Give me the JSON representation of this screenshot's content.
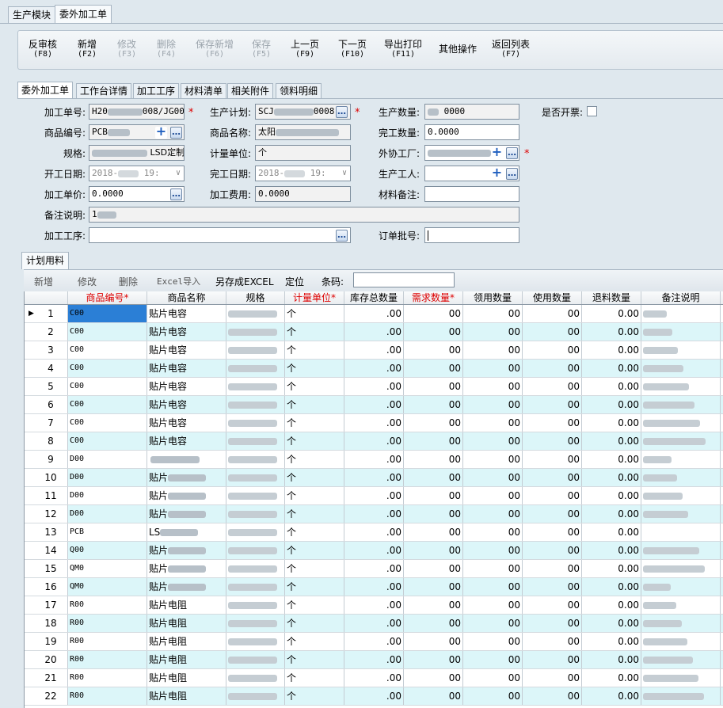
{
  "top_tabs": [
    {
      "label": "生产模块",
      "active": false
    },
    {
      "label": "委外加工单",
      "active": true
    }
  ],
  "toolbar": [
    {
      "label": "反审核",
      "key": "(F8)",
      "enabled": true
    },
    {
      "label": "新增",
      "key": "(F2)",
      "enabled": true
    },
    {
      "label": "修改",
      "key": "(F3)",
      "enabled": false
    },
    {
      "label": "删除",
      "key": "(F4)",
      "enabled": false
    },
    {
      "label": "保存新增",
      "key": "(F6)",
      "enabled": false
    },
    {
      "label": "保存",
      "key": "(F5)",
      "enabled": false
    },
    {
      "label": "上一页",
      "key": "(F9)",
      "enabled": true
    },
    {
      "label": "下一页",
      "key": "(F10)",
      "enabled": true
    },
    {
      "label": "导出打印",
      "key": "(F11)",
      "enabled": true
    },
    {
      "label": "其他操作",
      "key": "",
      "enabled": true
    },
    {
      "label": "返回列表",
      "key": "(F7)",
      "enabled": true
    }
  ],
  "sub_tabs": [
    {
      "label": "委外加工单",
      "active": true
    },
    {
      "label": "工作台详情",
      "active": false
    },
    {
      "label": "加工工序",
      "active": false
    },
    {
      "label": "材料清单",
      "active": false
    },
    {
      "label": "相关附件",
      "active": false
    },
    {
      "label": "领料明细",
      "active": false
    }
  ],
  "form": {
    "order_no_label": "加工单号:",
    "order_no_prefix": "H20",
    "order_no_suffix": "008/JG001",
    "plan_label": "生产计划:",
    "plan_prefix": "SCJ",
    "plan_suffix": "0008",
    "qty_label": "生产数量:",
    "qty_value": "0000",
    "invoice_label": "是否开票:",
    "product_code_label": "商品编号:",
    "product_code_value": "PCB",
    "product_name_label": "商品名称:",
    "product_name_value": "太阳",
    "done_qty_label": "完工数量:",
    "done_qty_value": "0.0000",
    "spec_label": "规格:",
    "spec_value": "LSD定制",
    "unit_label": "计量单位:",
    "unit_value": "个",
    "factory_label": "外协工厂:",
    "start_label": "开工日期:",
    "start_value": "2018-",
    "start_time": "19:",
    "end_label": "完工日期:",
    "end_value": "2018-",
    "end_time": "19:",
    "worker_label": "生产工人:",
    "price_label": "加工单价:",
    "price_value": "0.0000",
    "fee_label": "加工费用:",
    "fee_value": "0.0000",
    "material_note_label": "材料备注:",
    "remark_label": "备注说明:",
    "remark_value": "1",
    "process_label": "加工工序:",
    "batch_label": "订单批号:"
  },
  "grid_tab": "计划用料",
  "grid_toolbar": {
    "add": "新增",
    "edit": "修改",
    "delete": "删除",
    "excel_import": "Excel导入",
    "save_excel": "另存成EXCEL",
    "locate": "定位",
    "barcode_label": "条码:"
  },
  "columns": [
    "",
    "商品编号*",
    "商品名称",
    "规格",
    "计量单位*",
    "库存总数量",
    "需求数量*",
    "领用数量",
    "使用数量",
    "退料数量",
    "备注说明"
  ],
  "rows": [
    {
      "n": "1",
      "code": "C00",
      "name": "贴片电容",
      "unit": "个",
      "stock": ".00",
      "need": "00",
      "take": "00",
      "use": "00",
      "ret": "0.00"
    },
    {
      "n": "2",
      "code": "C00",
      "name": "贴片电容",
      "unit": "个",
      "stock": ".00",
      "need": "00",
      "take": "00",
      "use": "00",
      "ret": "0.00"
    },
    {
      "n": "3",
      "code": "C00",
      "name": "贴片电容",
      "unit": "个",
      "stock": ".00",
      "need": "00",
      "take": "00",
      "use": "00",
      "ret": "0.00"
    },
    {
      "n": "4",
      "code": "C00",
      "name": "贴片电容",
      "unit": "个",
      "stock": ".00",
      "need": "00",
      "take": "00",
      "use": "00",
      "ret": "0.00"
    },
    {
      "n": "5",
      "code": "C00",
      "name": "贴片电容",
      "unit": "个",
      "stock": ".00",
      "need": "00",
      "take": "00",
      "use": "00",
      "ret": "0.00"
    },
    {
      "n": "6",
      "code": "C00",
      "name": "贴片电容",
      "unit": "个",
      "stock": ".00",
      "need": "00",
      "take": "00",
      "use": "00",
      "ret": "0.00"
    },
    {
      "n": "7",
      "code": "C00",
      "name": "贴片电容",
      "unit": "个",
      "stock": ".00",
      "need": "00",
      "take": "00",
      "use": "00",
      "ret": "0.00"
    },
    {
      "n": "8",
      "code": "C00",
      "name": "贴片电容",
      "unit": "个",
      "stock": ".00",
      "need": "00",
      "take": "00",
      "use": "00",
      "ret": "0.00"
    },
    {
      "n": "9",
      "code": "D00",
      "name": "",
      "unit": "个",
      "stock": ".00",
      "need": "00",
      "take": "00",
      "use": "00",
      "ret": "0.00"
    },
    {
      "n": "10",
      "code": "D00",
      "name": "贴片",
      "unit": "个",
      "stock": ".00",
      "need": "00",
      "take": "00",
      "use": "00",
      "ret": "0.00"
    },
    {
      "n": "11",
      "code": "D00",
      "name": "贴片",
      "unit": "个",
      "stock": ".00",
      "need": "00",
      "take": "00",
      "use": "00",
      "ret": "0.00"
    },
    {
      "n": "12",
      "code": "D00",
      "name": "贴片",
      "unit": "个",
      "stock": ".00",
      "need": "00",
      "take": "00",
      "use": "00",
      "ret": "0.00"
    },
    {
      "n": "13",
      "code": "PCB",
      "name": "LS",
      "unit": "个",
      "stock": ".00",
      "need": "00",
      "take": "00",
      "use": "00",
      "ret": "0.00"
    },
    {
      "n": "14",
      "code": "Q00",
      "name": "贴片",
      "unit": "个",
      "stock": ".00",
      "need": "00",
      "take": "00",
      "use": "00",
      "ret": "0.00"
    },
    {
      "n": "15",
      "code": "QM0",
      "name": "贴片",
      "unit": "个",
      "stock": ".00",
      "need": "00",
      "take": "00",
      "use": "00",
      "ret": "0.00"
    },
    {
      "n": "16",
      "code": "QM0",
      "name": "贴片",
      "unit": "个",
      "stock": ".00",
      "need": "00",
      "take": "00",
      "use": "00",
      "ret": "0.00"
    },
    {
      "n": "17",
      "code": "R00",
      "name": "贴片电阻",
      "unit": "个",
      "stock": ".00",
      "need": "00",
      "take": "00",
      "use": "00",
      "ret": "0.00"
    },
    {
      "n": "18",
      "code": "R00",
      "name": "贴片电阻",
      "unit": "个",
      "stock": ".00",
      "need": "00",
      "take": "00",
      "use": "00",
      "ret": "0.00"
    },
    {
      "n": "19",
      "code": "R00",
      "name": "贴片电阻",
      "unit": "个",
      "stock": ".00",
      "need": "00",
      "take": "00",
      "use": "00",
      "ret": "0.00"
    },
    {
      "n": "20",
      "code": "R00",
      "name": "贴片电阻",
      "unit": "个",
      "stock": ".00",
      "need": "00",
      "take": "00",
      "use": "00",
      "ret": "0.00"
    },
    {
      "n": "21",
      "code": "R00",
      "name": "贴片电阻",
      "unit": "个",
      "stock": ".00",
      "need": "00",
      "take": "00",
      "use": "00",
      "ret": "0.00"
    },
    {
      "n": "22",
      "code": "R00",
      "name": "贴片电阻",
      "unit": "个",
      "stock": ".00",
      "need": "00",
      "take": "00",
      "use": "00",
      "ret": "0.00"
    }
  ],
  "colors": {
    "accent": "#2b7fd6",
    "required": "#dd0000",
    "row_alt": "#dcf6f9"
  }
}
